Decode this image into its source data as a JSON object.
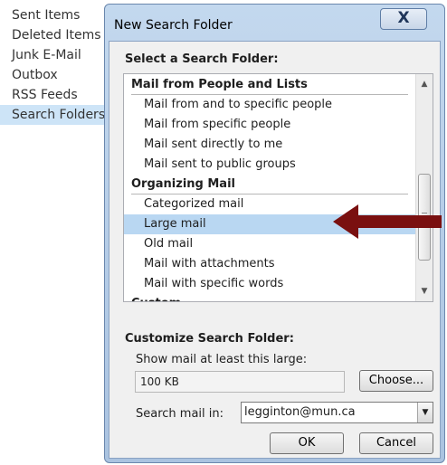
{
  "folder_pane": {
    "items": [
      {
        "label": "Sent Items",
        "selected": false
      },
      {
        "label": "Deleted Items",
        "selected": false
      },
      {
        "label": "Junk E-Mail",
        "selected": false
      },
      {
        "label": "Outbox",
        "selected": false
      },
      {
        "label": "RSS Feeds",
        "selected": false
      },
      {
        "label": "Search Folders",
        "selected": true
      }
    ]
  },
  "dialog": {
    "title": "New Search Folder",
    "close_glyph": "X",
    "select_label": "Select a Search Folder:",
    "list": [
      {
        "type": "group",
        "label": "Mail from People and Lists"
      },
      {
        "type": "option",
        "label": "Mail from and to specific people"
      },
      {
        "type": "option",
        "label": "Mail from specific people"
      },
      {
        "type": "option",
        "label": "Mail sent directly to me"
      },
      {
        "type": "option",
        "label": "Mail sent to public groups"
      },
      {
        "type": "group",
        "label": "Organizing Mail"
      },
      {
        "type": "option",
        "label": "Categorized mail"
      },
      {
        "type": "option",
        "label": "Large mail",
        "selected": true
      },
      {
        "type": "option",
        "label": "Old mail"
      },
      {
        "type": "option",
        "label": "Mail with attachments"
      },
      {
        "type": "option",
        "label": "Mail with specific words"
      },
      {
        "type": "group",
        "label": "Custom"
      }
    ],
    "customize_label": "Customize Search Folder:",
    "size_label": "Show mail at least this large:",
    "size_value": "100 KB",
    "choose_label": "Choose...",
    "search_in_label": "Search mail in:",
    "search_in_value": "legginton@mun.ca",
    "ok_label": "OK",
    "cancel_label": "Cancel"
  },
  "colors": {
    "selection": "#b9d7f2",
    "annotation_arrow": "#7a1010"
  },
  "icons": {
    "scroll_up": "triangle-up-icon",
    "scroll_down": "triangle-down-icon",
    "dropdown": "triangle-down-icon"
  }
}
